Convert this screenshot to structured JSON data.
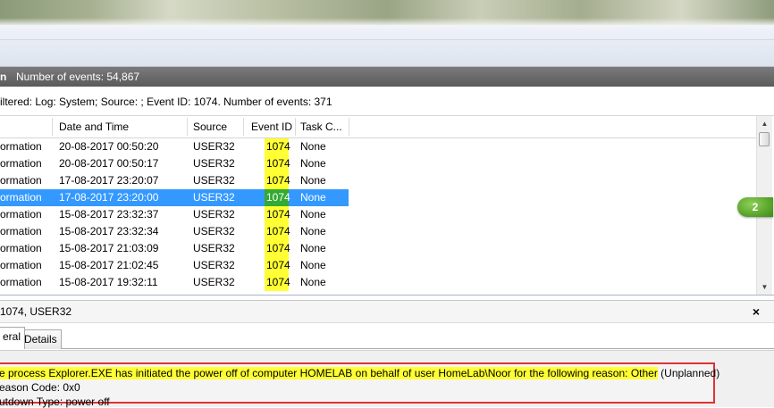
{
  "header": {
    "left_fragment": "n",
    "events_count": "Number of events: 54,867"
  },
  "filter": {
    "text": "iltered: Log: System; Source: ; Event ID: 1074. Number of events: 371"
  },
  "table": {
    "columns": [
      "Date and Time",
      "Source",
      "Event ID",
      "Task C..."
    ],
    "rows": [
      {
        "level": "ormation",
        "date": "20-08-2017 00:50:20",
        "source": "USER32",
        "event_id": "1074",
        "task": "None",
        "selected": false
      },
      {
        "level": "ormation",
        "date": "20-08-2017 00:50:17",
        "source": "USER32",
        "event_id": "1074",
        "task": "None",
        "selected": false
      },
      {
        "level": "ormation",
        "date": "17-08-2017 23:20:07",
        "source": "USER32",
        "event_id": "1074",
        "task": "None",
        "selected": false
      },
      {
        "level": "ormation",
        "date": "17-08-2017 23:20:00",
        "source": "USER32",
        "event_id": "1074",
        "task": "None",
        "selected": true
      },
      {
        "level": "ormation",
        "date": "15-08-2017 23:32:37",
        "source": "USER32",
        "event_id": "1074",
        "task": "None",
        "selected": false
      },
      {
        "level": "ormation",
        "date": "15-08-2017 23:32:34",
        "source": "USER32",
        "event_id": "1074",
        "task": "None",
        "selected": false
      },
      {
        "level": "ormation",
        "date": "15-08-2017 21:03:09",
        "source": "USER32",
        "event_id": "1074",
        "task": "None",
        "selected": false
      },
      {
        "level": "ormation",
        "date": "15-08-2017 21:02:45",
        "source": "USER32",
        "event_id": "1074",
        "task": "None",
        "selected": false
      },
      {
        "level": "ormation",
        "date": "15-08-2017 19:32:11",
        "source": "USER32",
        "event_id": "1074",
        "task": "None",
        "selected": false
      }
    ]
  },
  "callout": {
    "label": "2"
  },
  "detail": {
    "title": "1074, USER32",
    "close_glyph": "×",
    "tabs": [
      "eral",
      "Details"
    ]
  },
  "message": {
    "line1_highlighted": "e process Explorer.EXE has initiated the power off of computer HOMELAB on behalf of user HomeLab\\Noor for the following reason: Other",
    "line1_rest": " (Unplanned)",
    "line2": "eason Code: 0x0",
    "line3": "utdown Type: power off"
  },
  "colors": {
    "selection": "#3399ff",
    "highlight_yellow": "#ffff33",
    "highlight_green": "#33aa33",
    "annotation_red": "#e03232",
    "callout_green": "#5aa52c"
  },
  "icons": {
    "scroll_up": "scroll-up-arrow-icon",
    "scroll_down": "scroll-down-arrow-icon",
    "close": "close-icon"
  }
}
